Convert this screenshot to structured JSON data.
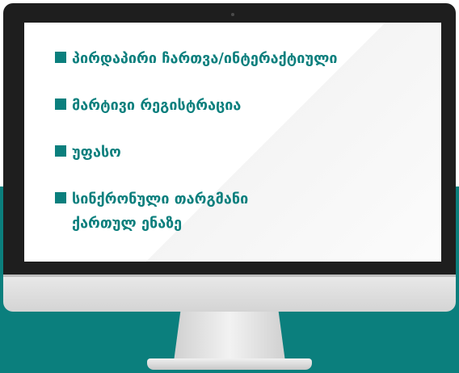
{
  "colors": {
    "accent": "#0b7f7d",
    "bezel": "#1e1e1e",
    "chin": "#dedede",
    "screen": "#ffffff"
  },
  "features": [
    {
      "text": "პირდაპირი ჩართვა/ინტერაქტიული"
    },
    {
      "text": "მარტივი რეგისტრაცია"
    },
    {
      "text": "უფასო"
    },
    {
      "text": "სინქრონული თარგმანი ქართულ ენაზე"
    }
  ]
}
